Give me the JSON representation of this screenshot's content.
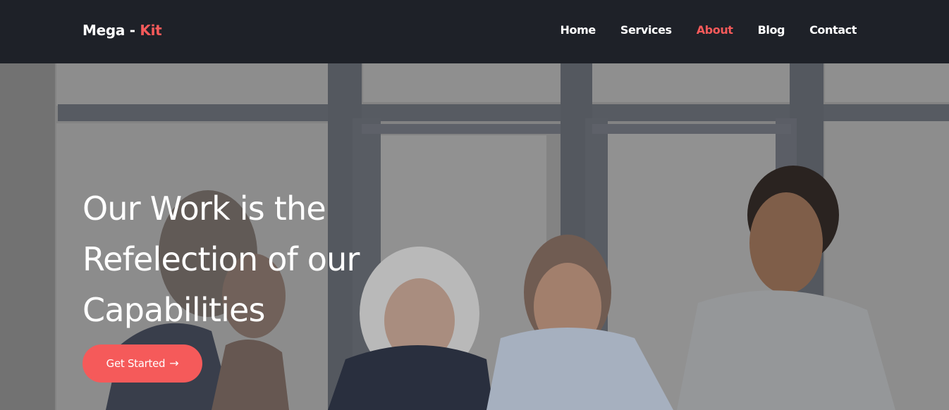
{
  "brand": {
    "name": "Mega - ",
    "accent": "Kit"
  },
  "nav": {
    "items": [
      {
        "label": "Home"
      },
      {
        "label": "Services"
      },
      {
        "label": "About",
        "active": true
      },
      {
        "label": "Blog"
      },
      {
        "label": "Contact"
      }
    ]
  },
  "hero": {
    "title_lines": [
      "Our Work is the",
      "Refelection of our",
      "Capabilities"
    ],
    "cta_label": "Get Started",
    "cta_icon": "arrow-right-icon"
  },
  "colors": {
    "accent": "#f55a5a",
    "nav_bg": "#1e2128",
    "text": "#ffffff"
  }
}
